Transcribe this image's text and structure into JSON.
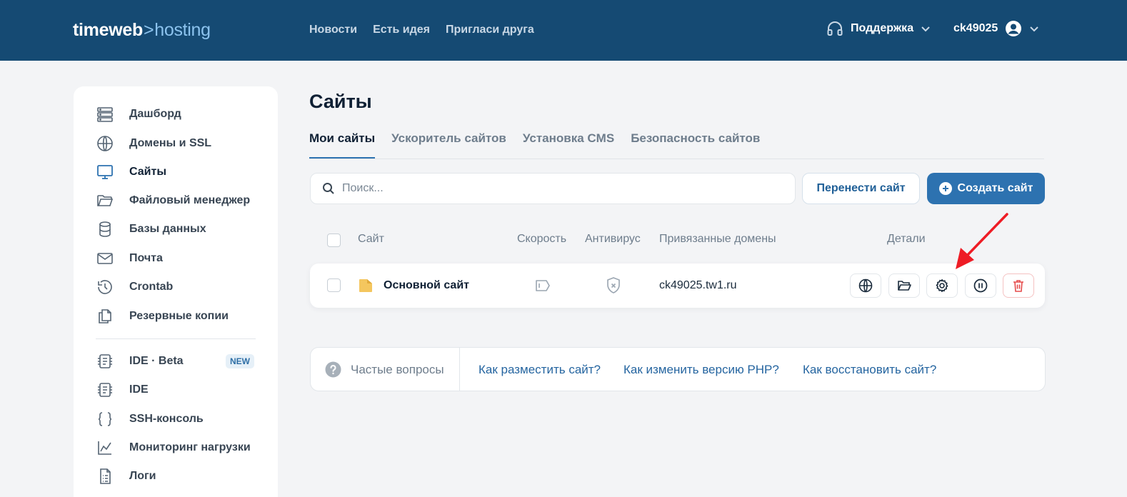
{
  "header": {
    "logo_brand": "timeweb",
    "logo_sep": ">",
    "logo_product": "hosting",
    "nav": [
      "Новости",
      "Есть идея",
      "Пригласи друга"
    ],
    "support_label": "Поддержка",
    "username": "ck49025"
  },
  "sidebar": {
    "items": [
      {
        "label": "Дашборд",
        "icon": "dashboard-icon"
      },
      {
        "label": "Домены и SSL",
        "icon": "globe-icon"
      },
      {
        "label": "Сайты",
        "icon": "monitor-icon"
      },
      {
        "label": "Файловый менеджер",
        "icon": "folder-icon"
      },
      {
        "label": "Базы данных",
        "icon": "database-icon"
      },
      {
        "label": "Почта",
        "icon": "mail-icon"
      },
      {
        "label": "Crontab",
        "icon": "history-icon"
      },
      {
        "label": "Резервные копии",
        "icon": "copy-icon"
      },
      {
        "label": "IDE · Beta",
        "icon": "ide-icon",
        "badge": "NEW"
      },
      {
        "label": "IDE",
        "icon": "ide-icon"
      },
      {
        "label": "SSH-консоль",
        "icon": "braces-icon"
      },
      {
        "label": "Мониторинг нагрузки",
        "icon": "chart-icon"
      },
      {
        "label": "Логи",
        "icon": "log-icon"
      }
    ],
    "active_label": "Сайты"
  },
  "main": {
    "title": "Сайты",
    "tabs": [
      "Мои сайты",
      "Ускоритель сайтов",
      "Установка CMS",
      "Безопасность сайтов"
    ],
    "search_placeholder": "Поиск...",
    "transfer_button": "Перенести сайт",
    "create_button": "Создать сайт",
    "table": {
      "columns": [
        "Сайт",
        "Скорость",
        "Антивирус",
        "Привязанные домены",
        "Детали"
      ],
      "rows": [
        {
          "site": "Основной сайт",
          "domain": "ck49025.tw1.ru"
        }
      ]
    },
    "faq": {
      "label": "Частые вопросы",
      "links": [
        "Как разместить сайт?",
        "Как изменить версию PHP?",
        "Как восстановить сайт?"
      ]
    }
  },
  "colors": {
    "header_bg": "#154a73",
    "accent": "#2d72b0",
    "danger": "#e54b4b",
    "annotation_arrow": "#ee1c25"
  }
}
